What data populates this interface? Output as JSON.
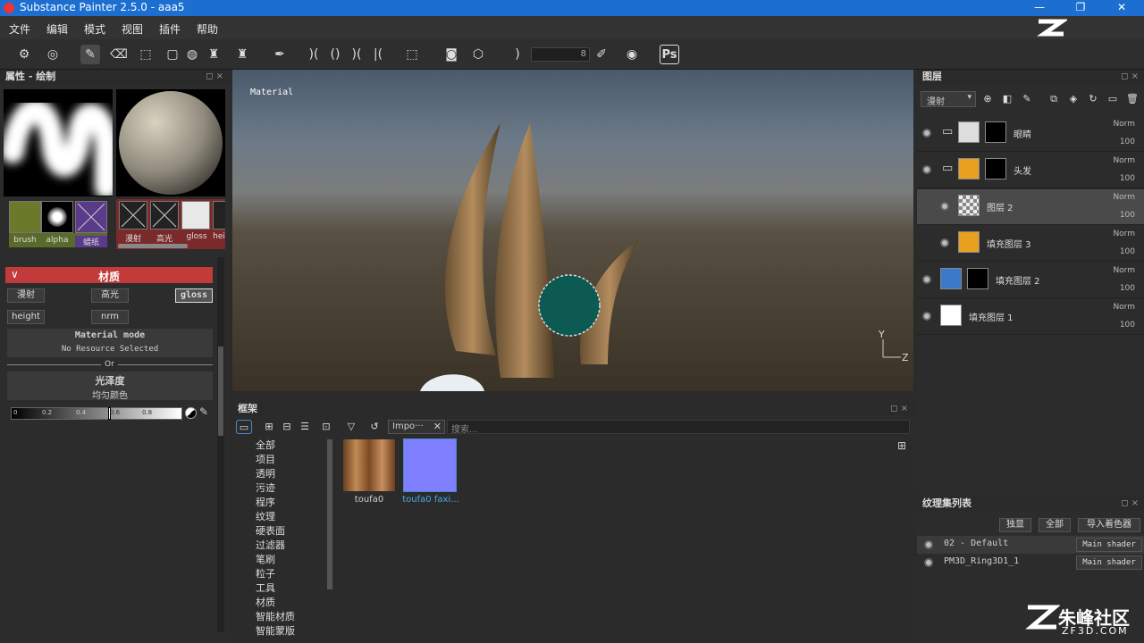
{
  "window": {
    "title": "Substance Painter 2.5.0 - aaa5",
    "min": "—",
    "max": "❐",
    "close": "✕"
  },
  "menu": [
    "文件",
    "编辑",
    "模式",
    "视图",
    "插件",
    "帮助"
  ],
  "toolbar": {
    "brush_size": "8",
    "ps_label": "Ps"
  },
  "left_panel": {
    "title": "属性 - 绘制",
    "brush_labels": [
      "brush",
      "alpha",
      "蜡纸"
    ],
    "channel_chips": [
      "漫射",
      "高光",
      "gloss",
      "hei"
    ],
    "material_header": "材质",
    "channels": [
      "漫射",
      "高光",
      "gloss",
      "height",
      "nrm"
    ],
    "material_mode_title": "Material mode",
    "material_mode_value": "No Resource Selected",
    "or_label": "Or",
    "gloss_title": "光泽度",
    "gloss_value": "均匀颜色",
    "slider_ticks": [
      "0",
      "0.2",
      "0.4",
      "0.6",
      "0.8"
    ]
  },
  "viewport": {
    "label": "Material",
    "axis_y": "Y",
    "axis_z": "Z"
  },
  "shelf": {
    "title": "框架",
    "filter_tag": "Impo···",
    "search_placeholder": "搜索...",
    "categories": [
      "全部",
      "项目",
      "透明",
      "污迹",
      "程序",
      "纹理",
      "硬表面",
      "过滤器",
      "笔刷",
      "粒子",
      "工具",
      "材质",
      "智能材质",
      "智能蒙版"
    ],
    "items": [
      {
        "label": "toufa0",
        "color": "#a06a3a"
      },
      {
        "label": "toufa0 faxi...",
        "color": "#7f7fff"
      }
    ]
  },
  "layers_panel": {
    "title": "图层",
    "channel_select": "漫射",
    "layers": [
      {
        "name": "眼睛",
        "blend": "Norm",
        "opacity": "100",
        "thumb": "#dddddd",
        "mask": "#000000",
        "folder": true
      },
      {
        "name": "头发",
        "blend": "Norm",
        "opacity": "100",
        "thumb": "#e8a020",
        "mask": "#000000",
        "folder": true
      },
      {
        "name": "图层 2",
        "blend": "Norm",
        "opacity": "100",
        "thumb": "checker",
        "mask": "",
        "folder": false
      },
      {
        "name": "填充图层 3",
        "blend": "Norm",
        "opacity": "100",
        "thumb": "#e8a020",
        "mask": "",
        "folder": false
      },
      {
        "name": "填充图层 2",
        "blend": "Norm",
        "opacity": "100",
        "thumb": "#3a7ac8",
        "mask": "#000000",
        "folder": false
      },
      {
        "name": "填充图层 1",
        "blend": "Norm",
        "opacity": "100",
        "thumb": "#ffffff",
        "mask": "",
        "folder": false
      }
    ]
  },
  "texture_sets": {
    "title": "纹理集列表",
    "buttons": [
      "独显",
      "全部",
      "导入着色器"
    ],
    "sets": [
      {
        "name": "02 - Default",
        "shader": "Main shader"
      },
      {
        "name": "PM3D_Ring3D1_1",
        "shader": "Main shader"
      }
    ]
  },
  "watermark": {
    "brand": "朱峰社区",
    "url": "ZF3D.COM"
  }
}
